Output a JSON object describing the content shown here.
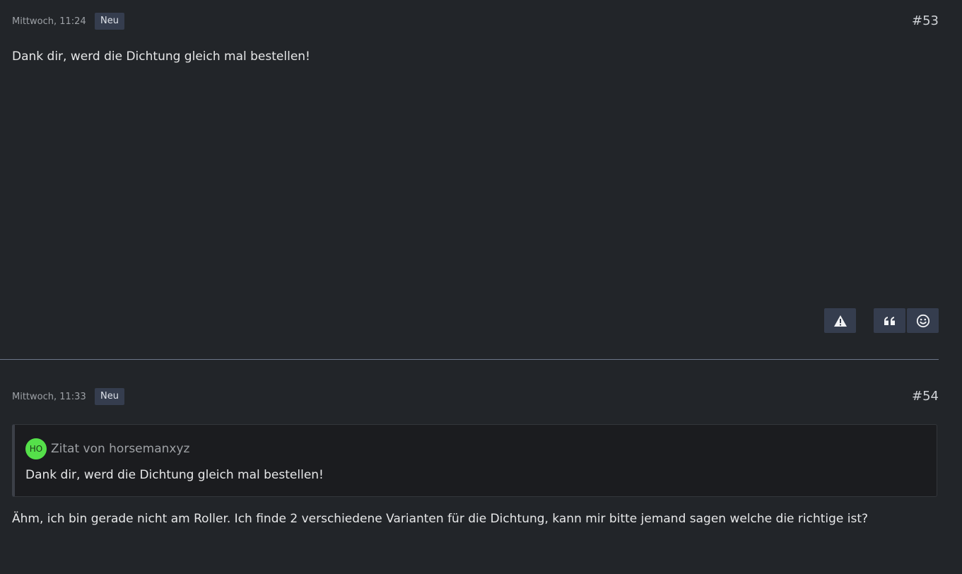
{
  "posts": [
    {
      "time": "Mittwoch, 11:24",
      "badge": "Neu",
      "number": "#53",
      "body": "Dank dir, werd die Dichtung gleich mal bestellen!",
      "actions": {
        "report_icon": "warning-icon",
        "quote_icon": "quote-icon",
        "react_icon": "smiley-icon"
      }
    },
    {
      "time": "Mittwoch, 11:33",
      "badge": "Neu",
      "number": "#54",
      "quote": {
        "avatar_initials": "HO",
        "avatar_color": "#55e04a",
        "author": "Zitat von horsemanxyz",
        "text": "Dank dir, werd die Dichtung gleich mal bestellen!"
      },
      "body": "Ähm, ich bin gerade nicht am Roller. Ich finde 2 verschiedene Varianten für die Dichtung, kann mir bitte jemand sagen welche die richtige ist?"
    }
  ],
  "colors": {
    "background": "#222529",
    "badge_bg": "#353d4e",
    "divider": "#6c7688",
    "quote_bg": "#1b1c1f"
  }
}
